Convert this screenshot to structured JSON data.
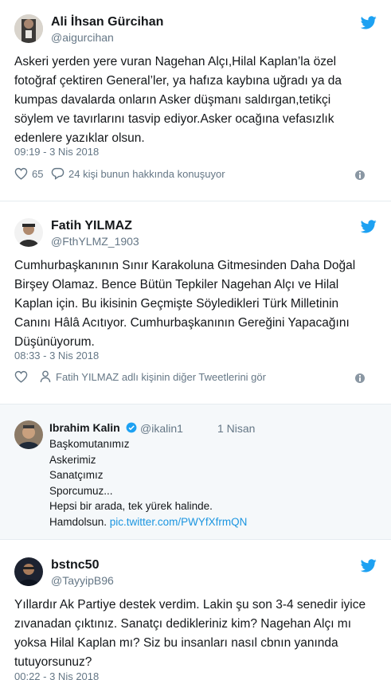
{
  "tweets": [
    {
      "name": "Ali İhsan Gürcihan",
      "handle": "@aigurcihan",
      "lines": [
        "Askeri yerden yere vuran Nagehan Alçı,Hilal Kaplan’la özel",
        "fotoğraf çektiren General’ler, ya hafıza kaybına uğradı ya da",
        "kumpas davalarda onların Asker düşmanı saldırgan,tetikçi",
        "söylem ve tavırlarını tasvip ediyor.Asker ocağına vefasızlık",
        "edenlere yazıklar olsun."
      ],
      "time": "09:19 - 3 Nis 2018",
      "likes": "65",
      "conversation": "24 kişi bunun hakkında konuşuyor"
    },
    {
      "name": "Fatih YILMAZ",
      "handle": "@FthYLMZ_1903",
      "lines": [
        "Cumhurbaşkanının Sınır Karakoluna Gitmesinden Daha Doğal",
        "Birşey Olamaz. Bence Bütün Tepkiler Nagehan Alçı ve Hilal",
        "Kaplan için. Bu ikisinin Geçmişte Söyledikleri Türk Milletinin",
        "Canını Hâlâ Acıtıyor. Cumhurbaşkanının Gereğini Yapacağını",
        "Düşünüyorum."
      ],
      "time": "08:33 - 3 Nis 2018",
      "more_tweets": "Fatih YILMAZ adlı kişinin diğer Tweetlerini gör"
    },
    {
      "name": "bstnc50",
      "handle": "@TayyipB96",
      "lines": [
        "Yıllardır Ak Partiye destek verdim. Lakin şu son 3-4 senedir iyice",
        "zıvanadan çıktınız. Sanatçı dedikleriniz kim? Nagehan Alçı mı",
        "yoksa Hilal Kaplan mı? Siz bu insanları nasıl cbnın yanında",
        "tutuyorsunuz?"
      ],
      "time": "00:22 - 3 Nis 2018"
    }
  ],
  "quoted": {
    "name": "Ibrahim Kalin",
    "handle": "@ikalin1",
    "date": "1 Nisan",
    "lines": [
      "Başkomutanımız",
      "Askerimiz",
      "Sanatçımız",
      "Sporcumuz...",
      "Hepsi bir arada, tek yürek halinde."
    ],
    "last_prefix": "Hamdolsun. ",
    "link": "pic.twitter.com/PWYfXfrmQN"
  },
  "colors": {
    "twitter_blue": "#1da1f2",
    "link_blue": "#1b95e0",
    "secondary_text": "#657786",
    "separator": "#e6ecf0",
    "quote_background": "#f5f8fa"
  },
  "icons": [
    "twitter-bird-icon",
    "heart-icon",
    "reply-bubble-icon",
    "person-icon",
    "info-icon",
    "verified-badge-icon"
  ]
}
